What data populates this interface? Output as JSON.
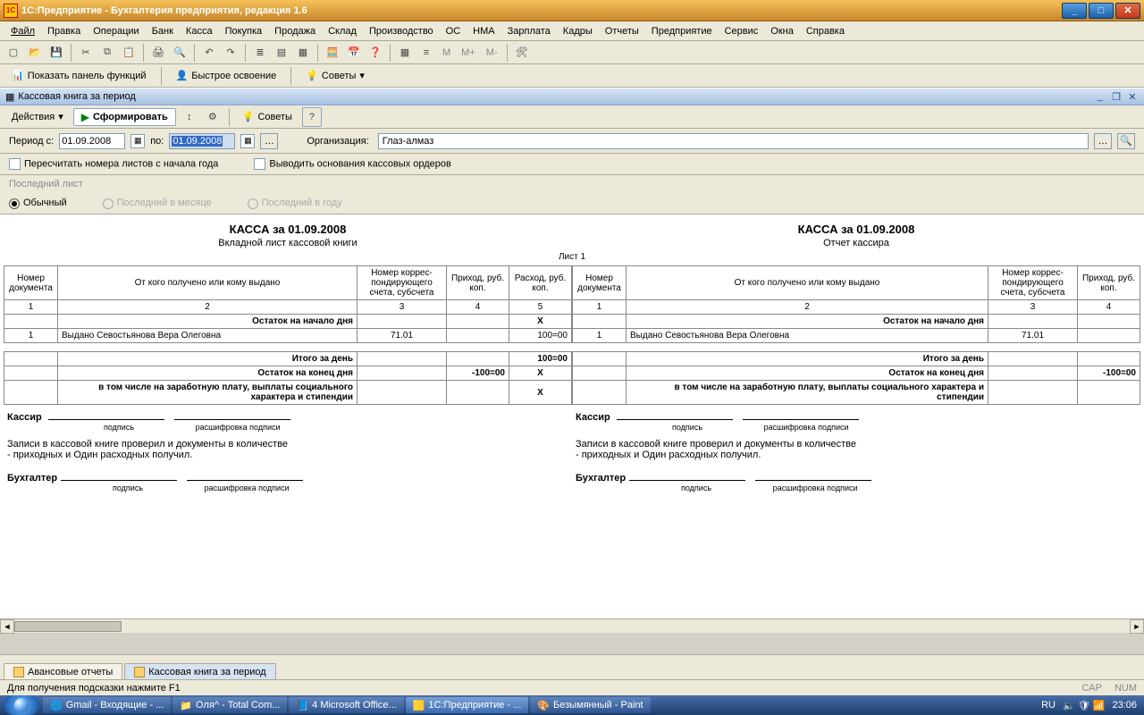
{
  "window": {
    "title": "1С:Предприятие - Бухгалтерия предприятия, редакция 1.6"
  },
  "menu": {
    "items": [
      "Файл",
      "Правка",
      "Операции",
      "Банк",
      "Касса",
      "Покупка",
      "Продажа",
      "Склад",
      "Производство",
      "ОС",
      "НМА",
      "Зарплата",
      "Кадры",
      "Отчеты",
      "Предприятие",
      "Сервис",
      "Окна",
      "Справка"
    ]
  },
  "toolbar2": {
    "show_panel": "Показать панель функций",
    "quick": "Быстрое освоение",
    "advice": "Советы"
  },
  "subwindow": {
    "title": "Кассовая книга за период"
  },
  "actions": {
    "actions": "Действия",
    "form": "Сформировать",
    "advice": "Советы"
  },
  "params": {
    "period_from_label": "Период с:",
    "date_from": "01.09.2008",
    "to_label": "по:",
    "date_to": "01.09.2008",
    "org_label": "Организация:",
    "org_value": "Глаз-алмаз"
  },
  "checks": {
    "recalc": "Пересчитать номера листов с начала года",
    "show_basis": "Выводить основания кассовых ордеров"
  },
  "group": {
    "last_sheet": "Последний лист"
  },
  "radios": {
    "normal": "Обычный",
    "last_month": "Последний в месяце",
    "last_year": "Последний в году"
  },
  "report": {
    "title_left": "КАССА за 01.09.2008",
    "subtitle_left": "Вкладной лист кассовой книги",
    "title_right": "КАССА за 01.09.2008",
    "subtitle_right": "Отчет кассира",
    "sheet": "Лист 1",
    "cols": {
      "num": "Номер документа",
      "from": "От кого получено или кому выдано",
      "corr": "Номер коррес-пондирующего счета, субсчета",
      "income": "Приход, руб. коп.",
      "expense": "Расход, руб. коп."
    },
    "colnums": [
      "1",
      "2",
      "3",
      "4",
      "5"
    ],
    "rows": {
      "start_balance": "Остаток на начало дня",
      "line1_num": "1",
      "line1_text": "Выдано Севостьянова Вера Олеговна",
      "line1_acc": "71.01",
      "line1_exp": "100=00",
      "total": "Итого за день",
      "total_exp": "100=00",
      "end_balance": "Остаток на конец  дня",
      "end_income": "-100=00",
      "wages": "в том числе на заработную плату, выплаты социального характера и стипендии",
      "x": "Х"
    },
    "sign": {
      "cashier": "Кассир",
      "accountant": "Бухгалтер",
      "signature": "подпись",
      "decode": "расшифровка подписи",
      "checked": "Записи в кассовой книге проверил и документы в количестве",
      "received": "- приходных и Один расходных получил."
    }
  },
  "bottom_tabs": {
    "t1": "Авансовые отчеты",
    "t2": "Кассовая книга за период"
  },
  "status": {
    "hint": "Для получения подсказки нажмите F1",
    "cap": "CAP",
    "num": "NUM"
  },
  "taskbar": {
    "items": [
      "Gmail - Входящие - ...",
      "Оля^ - Total Com...",
      "4 Microsoft Office...",
      "1С:Предприятие - ...",
      "Безымянный - Paint"
    ],
    "lang": "RU",
    "time": "23:06"
  }
}
